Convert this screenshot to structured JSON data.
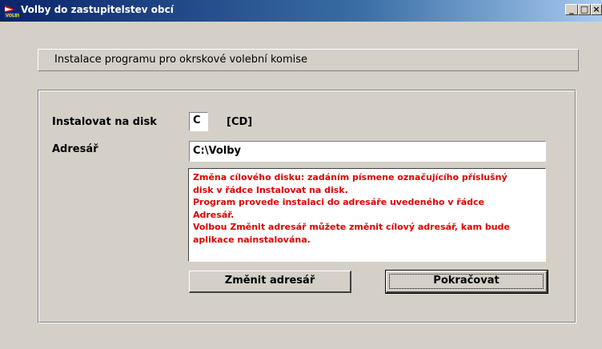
{
  "window": {
    "title": "Volby do zastupitelstev obcí",
    "minimize": "_",
    "maximize": "□",
    "close": "×"
  },
  "header": {
    "text": "Instalace programu pro okrskové volební komise"
  },
  "form": {
    "disk_label": "Instalovat na disk",
    "disk_value": "C",
    "disk_type": "[CD]",
    "dir_label": "Adresář",
    "dir_value": "C:\\Volby"
  },
  "info": {
    "lines": [
      "Změna cílového disku: zadáním písmene označujícího příslušný",
      "disk v řádce Instalovat na disk.",
      "Program provede instalaci do adresáře uvedeného v řádce",
      "Adresář.",
      "Volbou Změnit adresář můžete změnit cílový adresář, kam bude",
      "aplikace nainstalována."
    ]
  },
  "buttons": {
    "change_dir": "Změnit adresář",
    "continue": "Pokračovat"
  }
}
